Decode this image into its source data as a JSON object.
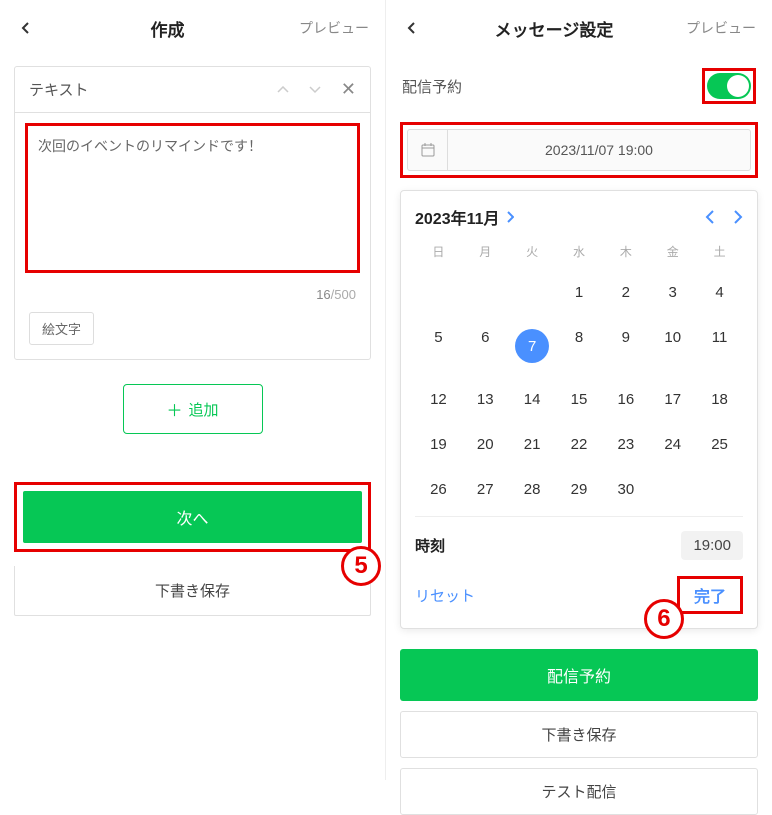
{
  "left": {
    "header": {
      "title": "作成",
      "preview": "プレビュー"
    },
    "card": {
      "type_label": "テキスト",
      "message": "次回のイベントのリマインドです！",
      "char_current": "16",
      "char_max": "500",
      "emoji_btn": "絵文字"
    },
    "add_btn": "追加",
    "next_btn": "次へ",
    "draft_btn": "下書き保存",
    "badge": "5"
  },
  "right": {
    "header": {
      "title": "メッセージ設定",
      "preview": "プレビュー"
    },
    "delivery_label": "配信予約",
    "datetime": "2023/11/07 19:00",
    "calendar": {
      "month_label": "2023年11月",
      "dow": [
        "日",
        "月",
        "火",
        "水",
        "木",
        "金",
        "土"
      ],
      "leading_blanks": 3,
      "days": [
        1,
        2,
        3,
        4,
        5,
        6,
        7,
        8,
        9,
        10,
        11,
        12,
        13,
        14,
        15,
        16,
        17,
        18,
        19,
        20,
        21,
        22,
        23,
        24,
        25,
        26,
        27,
        28,
        29,
        30
      ],
      "selected_day": 7,
      "time_label": "時刻",
      "time_value": "19:00",
      "reset": "リセット",
      "done": "完了"
    },
    "schedule_btn": "配信予約",
    "draft_btn": "下書き保存",
    "test_btn": "テスト配信",
    "badge": "6"
  }
}
